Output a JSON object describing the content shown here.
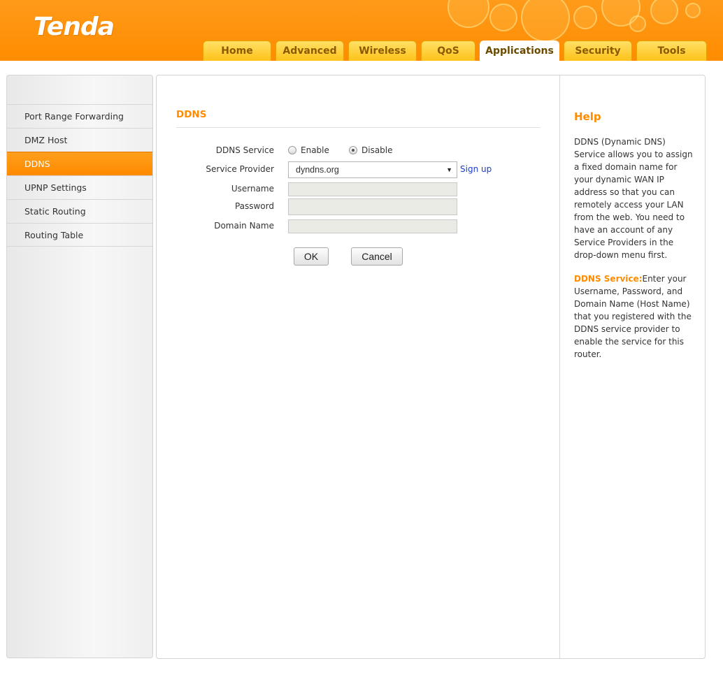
{
  "brand": {
    "logo": "Tenda"
  },
  "nav": {
    "tabs": [
      {
        "label": "Home"
      },
      {
        "label": "Advanced"
      },
      {
        "label": "Wireless"
      },
      {
        "label": "QoS"
      },
      {
        "label": "Applications",
        "active": true
      },
      {
        "label": "Security"
      },
      {
        "label": "Tools"
      }
    ]
  },
  "sidebar": {
    "items": [
      {
        "label": "Port Range Forwarding"
      },
      {
        "label": "DMZ Host"
      },
      {
        "label": "DDNS",
        "active": true
      },
      {
        "label": "UPNP Settings"
      },
      {
        "label": "Static Routing"
      },
      {
        "label": "Routing Table"
      }
    ]
  },
  "form": {
    "title": "DDNS",
    "ddns_service_label": "DDNS Service",
    "enable_label": "Enable",
    "disable_label": "Disable",
    "ddns_service_value": "Disable",
    "provider_label": "Service Provider",
    "provider_value": "dyndns.org",
    "signup_label": "Sign up",
    "username_label": "Username",
    "username_value": "",
    "password_label": "Password",
    "password_value": "",
    "domain_label": "Domain Name",
    "domain_value": "",
    "ok_label": "OK",
    "cancel_label": "Cancel"
  },
  "help": {
    "title": "Help",
    "paragraph1": "DDNS (Dynamic DNS) Service allows you to assign a fixed domain name for your dynamic WAN IP address so that you can remotely access your LAN from the web. You need to have an account of any Service Providers in the drop-down menu first.",
    "paragraph2_key": "DDNS Service:",
    "paragraph2_text": "Enter your Username, Password, and Domain Name (Host Name) that you registered with the DDNS service provider to enable the service for this router."
  },
  "colors": {
    "accent": "#ff8c00",
    "tab": "#ffc21a",
    "link": "#1a3ccc"
  }
}
